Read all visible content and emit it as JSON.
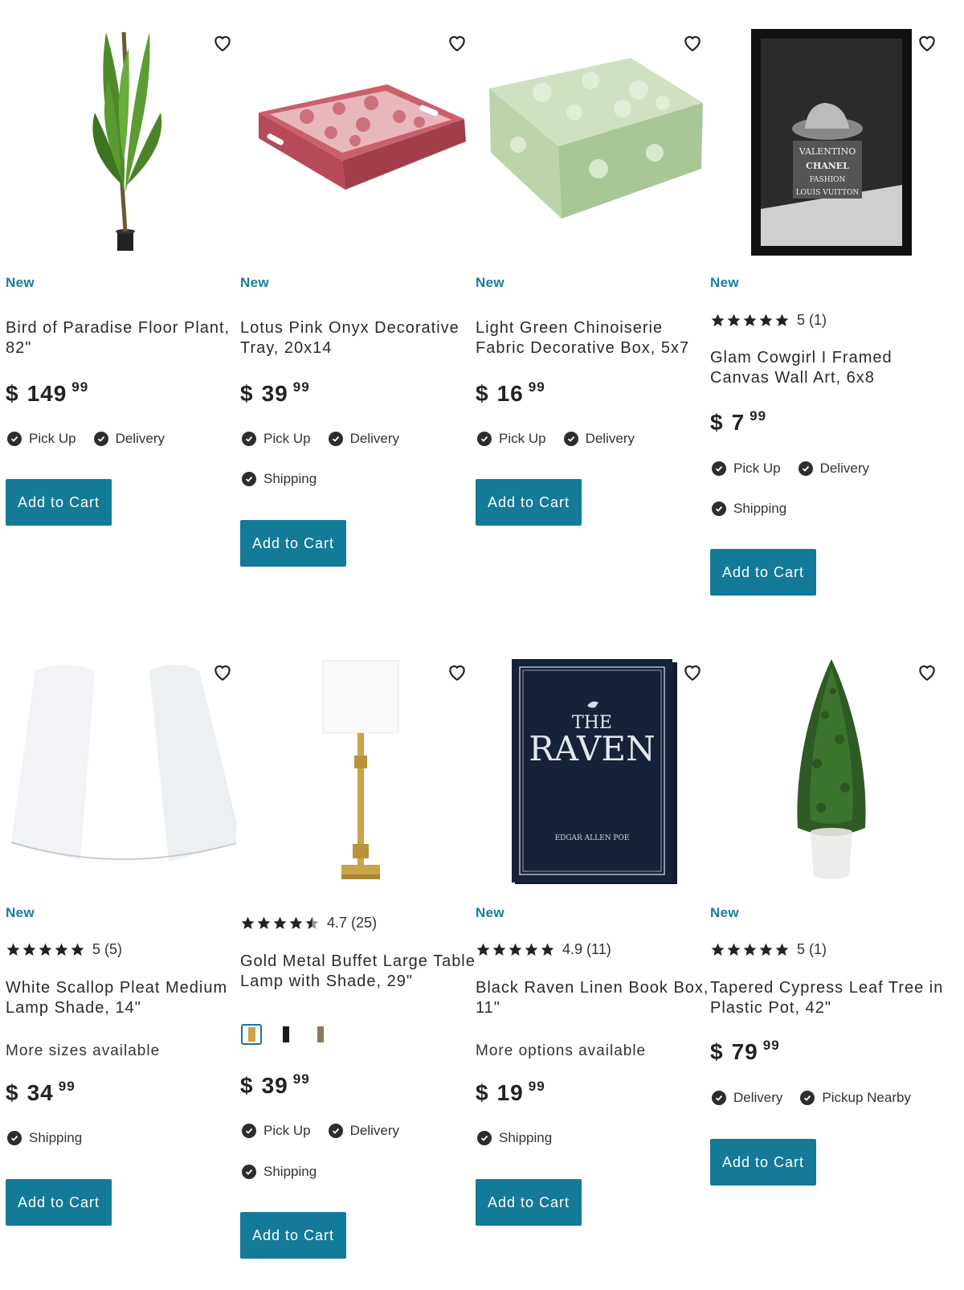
{
  "colors": {
    "accent": "#137a98",
    "new_tag": "#1a7d9a"
  },
  "products": [
    {
      "tag": "New",
      "title": "Bird of Paradise Floor Plant, 82\"",
      "price_dollars": "149",
      "price_cents": "99",
      "currency": "$",
      "fulfillment": [
        [
          "Pick Up",
          "Delivery"
        ]
      ],
      "button": "Add to Cart",
      "image": "palm-plant"
    },
    {
      "tag": "New",
      "title": "Lotus Pink Onyx Decorative Tray, 20x14",
      "price_dollars": "39",
      "price_cents": "99",
      "currency": "$",
      "fulfillment": [
        [
          "Pick Up",
          "Delivery"
        ],
        [
          "Shipping"
        ]
      ],
      "button": "Add to Cart",
      "image": "pink-tray"
    },
    {
      "tag": "New",
      "title": "Light Green Chinoiserie Fabric Decorative Box, 5x7",
      "price_dollars": "16",
      "price_cents": "99",
      "currency": "$",
      "fulfillment": [
        [
          "Pick Up",
          "Delivery"
        ]
      ],
      "button": "Add to Cart",
      "image": "green-box"
    },
    {
      "tag": "New",
      "rating": "5",
      "reviews": "(1)",
      "title": "Glam Cowgirl I Framed Canvas Wall Art, 6x8",
      "price_dollars": "7",
      "price_cents": "99",
      "currency": "$",
      "fulfillment": [
        [
          "Pick Up",
          "Delivery"
        ],
        [
          "Shipping"
        ]
      ],
      "button": "Add to Cart",
      "image": "framed-art"
    },
    {
      "tag": "New",
      "rating": "5",
      "reviews": "(5)",
      "title": "White Scallop Pleat Medium Lamp Shade, 14\"",
      "extra": "More sizes available",
      "price_dollars": "34",
      "price_cents": "99",
      "currency": "$",
      "fulfillment": [
        [
          "Shipping"
        ]
      ],
      "button": "Add to Cart",
      "image": "lamp-shade"
    },
    {
      "tag": "",
      "rating": "4.7",
      "reviews": "(25)",
      "title": "Gold Metal Buffet Large Table Lamp with Shade, 29\"",
      "price_dollars": "39",
      "price_cents": "99",
      "currency": "$",
      "fulfillment": [
        [
          "Pick Up",
          "Delivery"
        ],
        [
          "Shipping"
        ]
      ],
      "button": "Add to Cart",
      "image": "table-lamp"
    },
    {
      "tag": "New",
      "rating": "4.9",
      "reviews": "(11)",
      "title": "Black Raven Linen Book Box, 11\"",
      "extra": "More options available",
      "price_dollars": "19",
      "price_cents": "99",
      "currency": "$",
      "fulfillment": [
        [
          "Shipping"
        ]
      ],
      "button": "Add to Cart",
      "image": "raven-book"
    },
    {
      "tag": "New",
      "rating": "5",
      "reviews": "(1)",
      "title": "Tapered Cypress Leaf Tree in Plastic Pot, 42\"",
      "price_dollars": "79",
      "price_cents": "99",
      "currency": "$",
      "fulfillment": [
        [
          "Delivery",
          "Pickup Nearby"
        ]
      ],
      "button": "Add to Cart",
      "image": "cypress-tree"
    }
  ],
  "framed_art_text": [
    "VALENTINO",
    "CHANEL",
    "FASHION",
    "LOUIS VUITTON"
  ],
  "book": {
    "title_small": "THE",
    "title_big": "RAVEN",
    "author": "EDGAR ALLEN POE"
  }
}
